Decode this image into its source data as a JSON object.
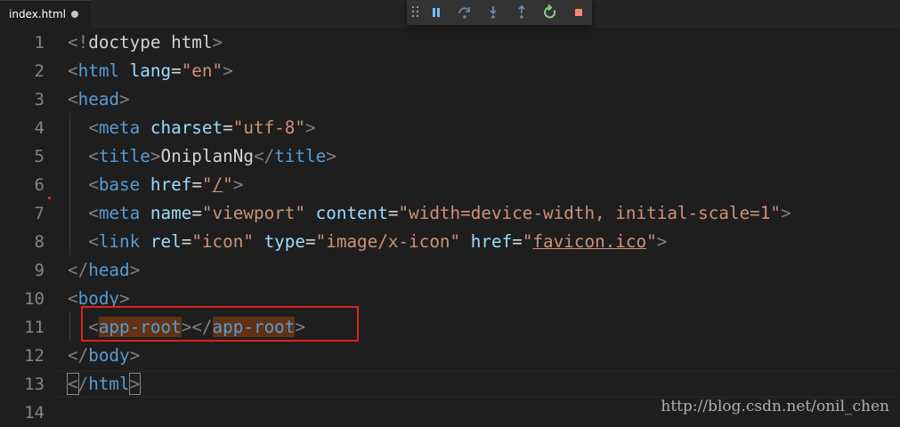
{
  "tab": {
    "title": "index.html"
  },
  "debug_toolbar": {
    "buttons": [
      {
        "id": "pause",
        "icon": "pause-icon",
        "color": "#75beff"
      },
      {
        "id": "step-over",
        "icon": "step-over-icon",
        "color": "#75beff"
      },
      {
        "id": "step-into",
        "icon": "step-into-icon",
        "color": "#75beff"
      },
      {
        "id": "step-out",
        "icon": "step-out-icon",
        "color": "#75beff"
      },
      {
        "id": "restart",
        "icon": "restart-icon",
        "color": "#89d185"
      },
      {
        "id": "stop",
        "icon": "stop-icon",
        "color": "#f48771"
      }
    ]
  },
  "editor": {
    "line_numbers": [
      "1",
      "2",
      "3",
      "4",
      "5",
      "6",
      "7",
      "8",
      "9",
      "10",
      "11",
      "12",
      "13",
      "14"
    ],
    "lines": [
      {
        "indent": "",
        "tokens": [
          {
            "t": "<!",
            "c": "punc"
          },
          {
            "t": "doctype",
            "c": "txt"
          },
          {
            "t": " html",
            "c": "txt"
          },
          {
            "t": ">",
            "c": "punc"
          }
        ]
      },
      {
        "indent": "",
        "tokens": [
          {
            "t": "<",
            "c": "punc"
          },
          {
            "t": "html",
            "c": "tag"
          },
          {
            "t": " lang",
            "c": "attr"
          },
          {
            "t": "=",
            "c": "txt"
          },
          {
            "t": "\"en\"",
            "c": "str"
          },
          {
            "t": ">",
            "c": "punc"
          }
        ]
      },
      {
        "indent": "",
        "tokens": [
          {
            "t": "<",
            "c": "punc"
          },
          {
            "t": "head",
            "c": "tag"
          },
          {
            "t": ">",
            "c": "punc"
          }
        ]
      },
      {
        "indent": "  ",
        "tokens": [
          {
            "t": "<",
            "c": "punc"
          },
          {
            "t": "meta",
            "c": "tag"
          },
          {
            "t": " charset",
            "c": "attr"
          },
          {
            "t": "=",
            "c": "txt"
          },
          {
            "t": "\"utf-8\"",
            "c": "str"
          },
          {
            "t": ">",
            "c": "punc"
          }
        ]
      },
      {
        "indent": "  ",
        "tokens": [
          {
            "t": "<",
            "c": "punc"
          },
          {
            "t": "title",
            "c": "tag"
          },
          {
            "t": ">",
            "c": "punc"
          },
          {
            "t": "OniplanNg",
            "c": "txt"
          },
          {
            "t": "</",
            "c": "punc"
          },
          {
            "t": "title",
            "c": "tag"
          },
          {
            "t": ">",
            "c": "punc"
          }
        ]
      },
      {
        "indent": "  ",
        "tokens": [
          {
            "t": "<",
            "c": "punc"
          },
          {
            "t": "base",
            "c": "tag"
          },
          {
            "t": " href",
            "c": "attr"
          },
          {
            "t": "=",
            "c": "txt"
          },
          {
            "t": "\"",
            "c": "str"
          },
          {
            "t": "/",
            "c": "str link"
          },
          {
            "t": "\"",
            "c": "str"
          },
          {
            "t": ">",
            "c": "punc"
          }
        ]
      },
      {
        "indent": "  ",
        "tokens": [
          {
            "t": "<",
            "c": "punc"
          },
          {
            "t": "meta",
            "c": "tag"
          },
          {
            "t": " name",
            "c": "attr"
          },
          {
            "t": "=",
            "c": "txt"
          },
          {
            "t": "\"viewport\"",
            "c": "str"
          },
          {
            "t": " content",
            "c": "attr"
          },
          {
            "t": "=",
            "c": "txt"
          },
          {
            "t": "\"width=device-width, initial-scale=1\"",
            "c": "str"
          },
          {
            "t": ">",
            "c": "punc"
          }
        ]
      },
      {
        "indent": "  ",
        "tokens": [
          {
            "t": "<",
            "c": "punc"
          },
          {
            "t": "link",
            "c": "tag"
          },
          {
            "t": " rel",
            "c": "attr"
          },
          {
            "t": "=",
            "c": "txt"
          },
          {
            "t": "\"icon\"",
            "c": "str"
          },
          {
            "t": " type",
            "c": "attr"
          },
          {
            "t": "=",
            "c": "txt"
          },
          {
            "t": "\"image/x-icon\"",
            "c": "str"
          },
          {
            "t": " href",
            "c": "attr"
          },
          {
            "t": "=",
            "c": "txt"
          },
          {
            "t": "\"",
            "c": "str"
          },
          {
            "t": "favicon.ico",
            "c": "str link"
          },
          {
            "t": "\"",
            "c": "str"
          },
          {
            "t": ">",
            "c": "punc"
          }
        ]
      },
      {
        "indent": "",
        "tokens": [
          {
            "t": "</",
            "c": "punc"
          },
          {
            "t": "head",
            "c": "tag"
          },
          {
            "t": ">",
            "c": "punc"
          }
        ]
      },
      {
        "indent": "",
        "tokens": [
          {
            "t": "<",
            "c": "punc"
          },
          {
            "t": "body",
            "c": "tag"
          },
          {
            "t": ">",
            "c": "punc"
          }
        ]
      },
      {
        "indent": "  ",
        "tokens": [
          {
            "t": "<",
            "c": "punc"
          },
          {
            "t": "app-root",
            "c": "tag hl"
          },
          {
            "t": ">",
            "c": "punc"
          },
          {
            "t": "</",
            "c": "punc"
          },
          {
            "t": "app-root",
            "c": "tag hl"
          },
          {
            "t": ">",
            "c": "punc"
          }
        ]
      },
      {
        "indent": "",
        "tokens": [
          {
            "t": "</",
            "c": "punc"
          },
          {
            "t": "body",
            "c": "tag"
          },
          {
            "t": ">",
            "c": "punc"
          }
        ]
      },
      {
        "indent": "",
        "tokens": [
          {
            "t": "<",
            "c": "punc bracket-box"
          },
          {
            "t": "/",
            "c": "punc"
          },
          {
            "t": "html",
            "c": "tag"
          },
          {
            "t": ">",
            "c": "punc bracket-box"
          }
        ]
      },
      {
        "indent": "",
        "tokens": []
      }
    ]
  },
  "watermark": {
    "text": "http://blog.csdn.net/onil_chen"
  },
  "colors": {
    "background": "#1e1e1e",
    "tag": "#569cd6",
    "attribute": "#9cdcfe",
    "string": "#ce9178",
    "punctuation": "#808080",
    "match_highlight": "#613214",
    "annotation_box": "#e02020"
  }
}
